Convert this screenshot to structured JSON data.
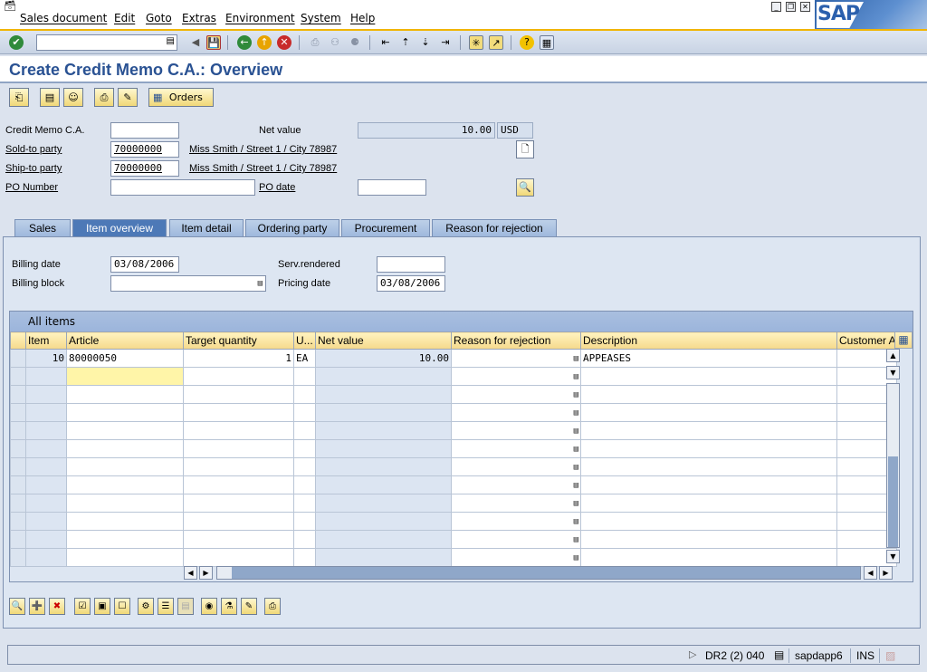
{
  "menu": {
    "items": [
      "Sales document",
      "Edit",
      "Goto",
      "Extras",
      "Environment",
      "System",
      "Help"
    ]
  },
  "brand": {
    "logo_text": "SAP"
  },
  "page": {
    "title": "Create Credit Memo C.A.: Overview"
  },
  "app_toolbar": {
    "orders_label": "Orders"
  },
  "header": {
    "credit_memo_label": "Credit Memo C.A.",
    "credit_memo_value": "",
    "net_value_label": "Net value",
    "net_value": "10.00",
    "currency": "USD",
    "sold_to_label": "Sold-to party",
    "sold_to_value": "70000000",
    "sold_to_address": "Miss Smith / Street 1 / City 78987",
    "ship_to_label": "Ship-to party",
    "ship_to_value": "70000000",
    "ship_to_address": "Miss Smith / Street 1 / City 78987",
    "po_number_label": "PO Number",
    "po_number_value": "",
    "po_date_label": "PO date",
    "po_date_value": ""
  },
  "tabs": [
    {
      "label": "Sales"
    },
    {
      "label": "Item overview"
    },
    {
      "label": "Item detail"
    },
    {
      "label": "Ordering party"
    },
    {
      "label": "Procurement"
    },
    {
      "label": "Reason for rejection"
    }
  ],
  "item_overview": {
    "billing_date_label": "Billing date",
    "billing_date_value": "03/08/2006",
    "billing_block_label": "Billing block",
    "billing_block_value": "",
    "serv_rendered_label": "Serv.rendered",
    "serv_rendered_value": "",
    "pricing_date_label": "Pricing date",
    "pricing_date_value": "03/08/2006"
  },
  "table": {
    "title": "All items",
    "columns": [
      "Item",
      "Article",
      "Target quantity",
      "U...",
      "Net value",
      "Reason for rejection",
      "Description",
      "Customer A"
    ],
    "rows": [
      {
        "item": "10",
        "article": "80000050",
        "target_qty": "1",
        "unit": "EA",
        "net_value": "10.00",
        "reason": "",
        "description": "APPEASES",
        "customer": ""
      }
    ]
  },
  "status": {
    "system": "DR2 (2) 040",
    "server": "sapdapp6",
    "mode": "INS"
  },
  "colors": {
    "accent": "#2a5293",
    "toolbar_stripe": "#f0b400"
  }
}
